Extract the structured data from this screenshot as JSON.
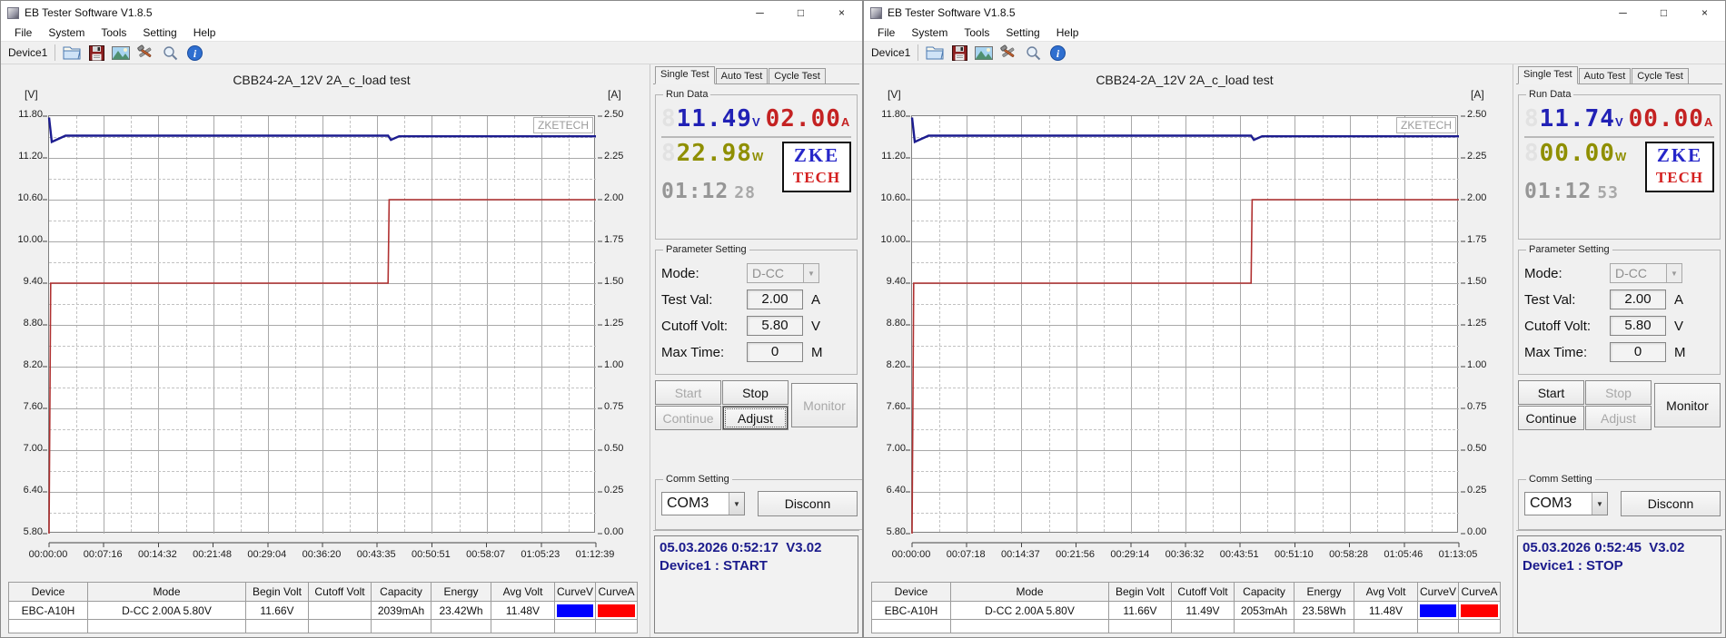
{
  "shared": {
    "title": "EB Tester Software V1.8.5",
    "menu": [
      "File",
      "System",
      "Tools",
      "Setting",
      "Help"
    ],
    "device_label": "Device1",
    "tabs": [
      "Single Test",
      "Auto Test",
      "Cycle Test"
    ],
    "groups": {
      "run_data": "Run Data",
      "param": "Parameter Setting",
      "comm": "Comm Setting"
    },
    "ghost_digit": "8",
    "logo": {
      "line1": "ZKE",
      "line2": "TECH"
    },
    "watermark": "ZKETECH",
    "params": {
      "mode_label": "Mode:",
      "mode_value": "D-CC",
      "testval_label": "Test Val:",
      "testval_value": "2.00",
      "testval_unit": "A",
      "cutoff_label": "Cutoff Volt:",
      "cutoff_value": "5.80",
      "cutoff_unit": "V",
      "maxtime_label": "Max Time:",
      "maxtime_value": "0",
      "maxtime_unit": "M"
    },
    "comm": {
      "port": "COM3",
      "disconnect_label": "Disconn"
    },
    "icons": {
      "dropdown": "▼",
      "minimize": "─",
      "maximize": "□",
      "close": "×"
    },
    "colors": {
      "voltage": "#2121b5",
      "current": "#c42222",
      "power": "#8f8f00",
      "time": "#969696",
      "curve_v": "#0000ff",
      "curve_a": "#ff0000"
    }
  },
  "windows": [
    {
      "run": {
        "voltage": "11.49",
        "voltage_unit": "V",
        "current": "02.00",
        "current_unit": "A",
        "power": "22.98",
        "power_unit": "W",
        "time": "01:12",
        "time_sec": "28"
      },
      "controls": {
        "start": {
          "label": "Start",
          "enabled": false
        },
        "stop": {
          "label": "Stop",
          "enabled": true
        },
        "continue": {
          "label": "Continue",
          "enabled": false
        },
        "adjust": {
          "label": "Adjust",
          "enabled": true,
          "focused": true
        },
        "monitor": {
          "label": "Monitor",
          "enabled": false
        }
      },
      "status": {
        "line1": "05.03.2026 0:52:17  V3.02",
        "line2": "Device1 : START"
      },
      "table": {
        "headers": [
          "Device",
          "Mode",
          "Begin Volt",
          "Cutoff Volt",
          "Capacity",
          "Energy",
          "Avg Volt",
          "CurveV",
          "CurveA"
        ],
        "rows": [
          [
            "EBC-A10H",
            "D-CC  2.00A  5.80V",
            "11.66V",
            "",
            "2039mAh",
            "23.42Wh",
            "11.48V",
            "#0000ff",
            "#ff0000"
          ]
        ]
      },
      "chart_data": {
        "type": "line",
        "title": "CBB24-2A_12V 2A_c_load test",
        "x_ticks": [
          "00:00:00",
          "00:07:16",
          "00:14:32",
          "00:21:48",
          "00:29:04",
          "00:36:20",
          "00:43:35",
          "00:50:51",
          "00:58:07",
          "01:05:23",
          "01:12:39"
        ],
        "y_left": {
          "label": "[V]",
          "min": 5.8,
          "max": 11.8,
          "ticks": [
            "11.80",
            "11.20",
            "10.60",
            "10.00",
            "9.40",
            "8.80",
            "8.20",
            "7.60",
            "7.00",
            "6.40",
            "5.80"
          ]
        },
        "y_right": {
          "label": "[A]",
          "min": 0,
          "max": 2.5,
          "ticks": [
            "2.50",
            "2.25",
            "2.00",
            "1.75",
            "1.50",
            "1.25",
            "1.00",
            "0.75",
            "0.50",
            "0.25",
            "0.00"
          ]
        },
        "series": [
          {
            "name": "Voltage",
            "axis": "left",
            "color": "#1c1c8f",
            "width": 2.4,
            "points": [
              [
                0,
                11.78
              ],
              [
                0.005,
                11.43
              ],
              [
                0.03,
                11.52
              ],
              [
                0.62,
                11.52
              ],
              [
                0.625,
                11.46
              ],
              [
                0.64,
                11.51
              ],
              [
                1,
                11.51
              ]
            ]
          },
          {
            "name": "Current",
            "axis": "right",
            "color": "#b03030",
            "width": 1.6,
            "points": [
              [
                0,
                0
              ],
              [
                0.003,
                1.5
              ],
              [
                0.62,
                1.5
              ],
              [
                0.622,
                2.0
              ],
              [
                1,
                2.0
              ]
            ]
          }
        ]
      }
    },
    {
      "run": {
        "voltage": "11.74",
        "voltage_unit": "V",
        "current": "00.00",
        "current_unit": "A",
        "power": "00.00",
        "power_unit": "W",
        "time": "01:12",
        "time_sec": "53"
      },
      "controls": {
        "start": {
          "label": "Start",
          "enabled": true
        },
        "stop": {
          "label": "Stop",
          "enabled": false
        },
        "continue": {
          "label": "Continue",
          "enabled": true
        },
        "adjust": {
          "label": "Adjust",
          "enabled": false
        },
        "monitor": {
          "label": "Monitor",
          "enabled": true
        }
      },
      "status": {
        "line1": "05.03.2026 0:52:45  V3.02",
        "line2": "Device1 : STOP"
      },
      "table": {
        "headers": [
          "Device",
          "Mode",
          "Begin Volt",
          "Cutoff Volt",
          "Capacity",
          "Energy",
          "Avg Volt",
          "CurveV",
          "CurveA"
        ],
        "rows": [
          [
            "EBC-A10H",
            "D-CC  2.00A  5.80V",
            "11.66V",
            "11.49V",
            "2053mAh",
            "23.58Wh",
            "11.48V",
            "#0000ff",
            "#ff0000"
          ]
        ]
      },
      "chart_data": {
        "type": "line",
        "title": "CBB24-2A_12V 2A_c_load test",
        "x_ticks": [
          "00:00:00",
          "00:07:18",
          "00:14:37",
          "00:21:56",
          "00:29:14",
          "00:36:32",
          "00:43:51",
          "00:51:10",
          "00:58:28",
          "01:05:46",
          "01:13:05"
        ],
        "y_left": {
          "label": "[V]",
          "min": 5.8,
          "max": 11.8,
          "ticks": [
            "11.80",
            "11.20",
            "10.60",
            "10.00",
            "9.40",
            "8.80",
            "8.20",
            "7.60",
            "7.00",
            "6.40",
            "5.80"
          ]
        },
        "y_right": {
          "label": "[A]",
          "min": 0,
          "max": 2.5,
          "ticks": [
            "2.50",
            "2.25",
            "2.00",
            "1.75",
            "1.50",
            "1.25",
            "1.00",
            "0.75",
            "0.50",
            "0.25",
            "0.00"
          ]
        },
        "series": [
          {
            "name": "Voltage",
            "axis": "left",
            "color": "#1c1c8f",
            "width": 2.4,
            "points": [
              [
                0,
                11.78
              ],
              [
                0.005,
                11.43
              ],
              [
                0.03,
                11.52
              ],
              [
                0.62,
                11.52
              ],
              [
                0.625,
                11.46
              ],
              [
                0.64,
                11.51
              ],
              [
                1,
                11.51
              ]
            ]
          },
          {
            "name": "Current",
            "axis": "right",
            "color": "#b03030",
            "width": 1.6,
            "points": [
              [
                0,
                0
              ],
              [
                0.003,
                1.5
              ],
              [
                0.62,
                1.5
              ],
              [
                0.622,
                2.0
              ],
              [
                1,
                2.0
              ]
            ]
          }
        ]
      }
    }
  ]
}
